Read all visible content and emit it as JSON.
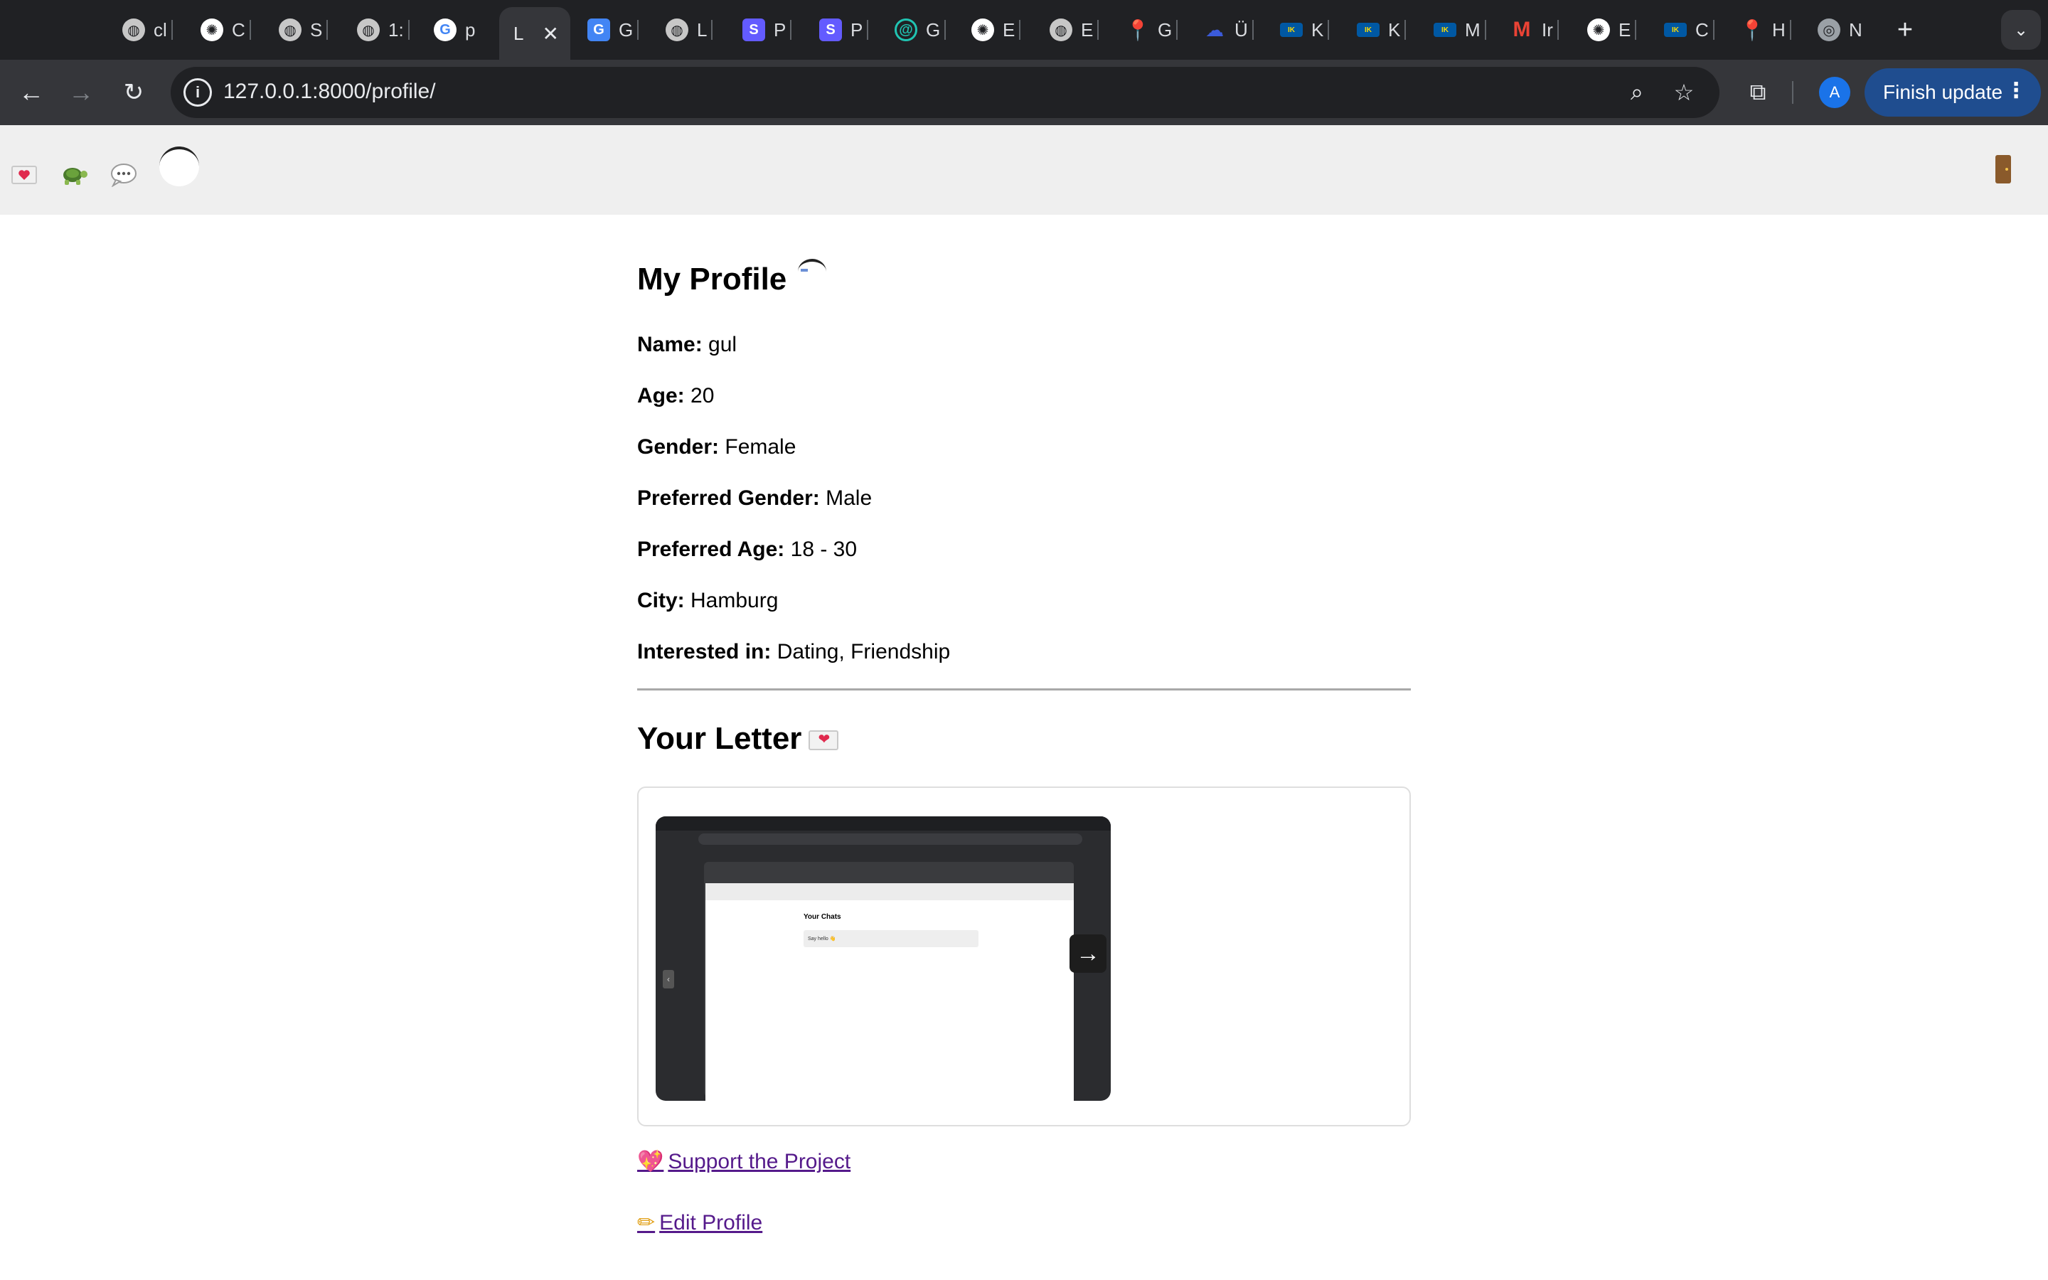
{
  "browser": {
    "tabs": [
      {
        "title": "cl",
        "icon": "globe-icon"
      },
      {
        "title": "C",
        "icon": "openai-icon"
      },
      {
        "title": "S",
        "icon": "globe-icon"
      },
      {
        "title": "1:",
        "icon": "globe-icon"
      },
      {
        "title": "p",
        "icon": "google-icon"
      },
      {
        "title": "L",
        "icon": "none",
        "active": true
      },
      {
        "title": "G",
        "icon": "google-translate-icon"
      },
      {
        "title": "L",
        "icon": "globe-icon"
      },
      {
        "title": "P",
        "icon": "stripe-icon"
      },
      {
        "title": "P",
        "icon": "stripe-icon"
      },
      {
        "title": "G",
        "icon": "spiral-icon"
      },
      {
        "title": "E",
        "icon": "openai-icon"
      },
      {
        "title": "E",
        "icon": "globe-icon"
      },
      {
        "title": "G",
        "icon": "maps-pin-icon"
      },
      {
        "title": "Ü",
        "icon": "cloud-icon"
      },
      {
        "title": "K",
        "icon": "ikea-icon"
      },
      {
        "title": "K",
        "icon": "ikea-icon"
      },
      {
        "title": "M",
        "icon": "ikea-icon"
      },
      {
        "title": "Ir",
        "icon": "gmail-icon"
      },
      {
        "title": "E",
        "icon": "openai-icon"
      },
      {
        "title": "C",
        "icon": "ikea-icon"
      },
      {
        "title": "H",
        "icon": "maps-pin-icon"
      },
      {
        "title": "N",
        "icon": "chrome-icon"
      }
    ],
    "url": "127.0.0.1:8000/profile/",
    "avatar_letter": "A",
    "finish_update_label": "Finish update"
  },
  "nav": {
    "items": [
      "letter-heart-icon",
      "turtle-icon",
      "speech-bubble-icon",
      "avatar"
    ],
    "logout_icon": "door-icon"
  },
  "profile": {
    "heading": "My Profile",
    "fields": [
      {
        "label": "Name:",
        "value": "gul"
      },
      {
        "label": "Age:",
        "value": "20"
      },
      {
        "label": "Gender:",
        "value": "Female"
      },
      {
        "label": "Preferred Gender:",
        "value": "Male"
      },
      {
        "label": "Preferred Age:",
        "value": "18 - 30"
      },
      {
        "label": "City:",
        "value": "Hamburg"
      },
      {
        "label": "Interested in:",
        "value": "Dating, Friendship"
      }
    ]
  },
  "letter": {
    "heading": "Your Letter",
    "heading_icon": "letter-heart-icon",
    "screenshot": {
      "inner_heading": "Your Chats",
      "inner_row": "Say hello 👋"
    },
    "next_arrow": "→"
  },
  "links": {
    "support": "Support the Project",
    "edit": "Edit Profile"
  },
  "colors": {
    "link": "#551a8b",
    "finish_update_bg": "#1f4d8f",
    "nav_bg": "#efefef",
    "tabstrip_bg": "#202124",
    "toolbar_bg": "#35363a"
  }
}
